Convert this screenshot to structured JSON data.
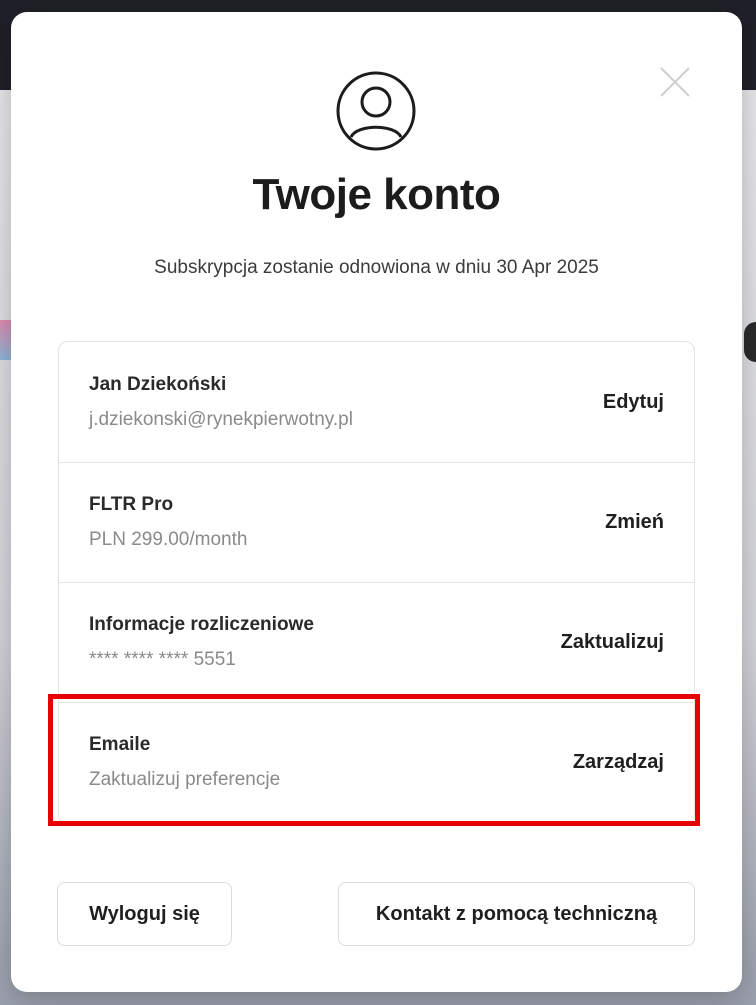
{
  "modal": {
    "title": "Twoje konto",
    "subtitle": "Subskrypcja zostanie odnowiona w dniu 30 Apr 2025",
    "close_icon": "close-icon",
    "avatar_icon": "user-circle-icon"
  },
  "account_rows": [
    {
      "title": "Jan Dziekoński",
      "subtitle": "j.dziekonski@rynekpierwotny.pl",
      "action": "Edytuj"
    },
    {
      "title": "FLTR Pro",
      "subtitle": "PLN 299.00/month",
      "action": "Zmień"
    },
    {
      "title": "Informacje rozliczeniowe",
      "subtitle": "**** **** **** 5551",
      "action": "Zaktualizuj"
    },
    {
      "title": "Emaile",
      "subtitle": "Zaktualizuj preferencje",
      "action": "Zarządzaj"
    }
  ],
  "footer": {
    "logout_label": "Wyloguj się",
    "support_label": "Kontakt z pomocą techniczną"
  },
  "colors": {
    "highlight": "#e60000",
    "text_primary": "#1c1c1c",
    "text_muted": "#8a8a8a"
  }
}
